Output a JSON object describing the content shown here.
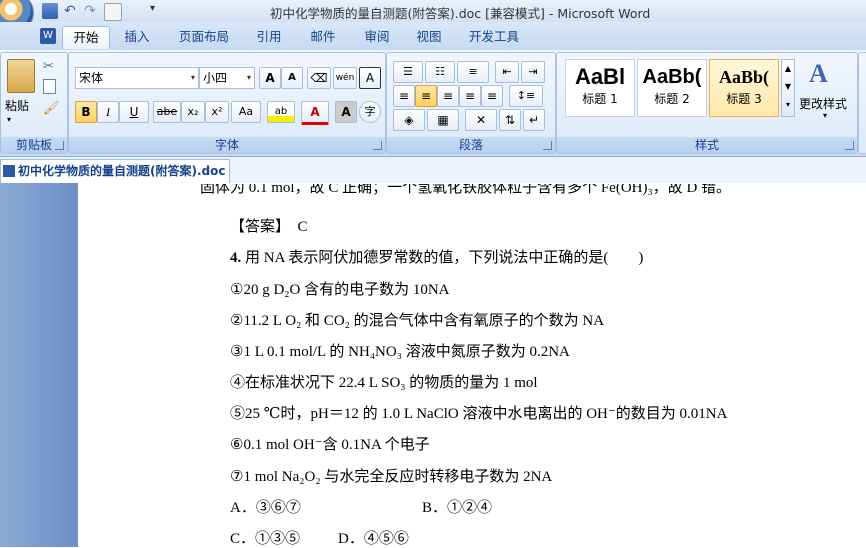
{
  "window": {
    "title": "初中化学物质的量自测题(附答案).doc [兼容模式] - Microsoft Word"
  },
  "tabs": [
    "开始",
    "插入",
    "页面布局",
    "引用",
    "邮件",
    "审阅",
    "视图",
    "开发工具"
  ],
  "ribbon": {
    "clipboard": {
      "label": "剪贴板",
      "paste": "粘贴"
    },
    "font": {
      "label": "字体",
      "font_name": "宋体",
      "font_size": "小四",
      "grow": "A",
      "shrink": "A",
      "bold": "B",
      "italic": "I",
      "underline": "U",
      "strike": "abe",
      "sub": "x₂",
      "sup": "x²",
      "case": "Aa",
      "wen": "wén",
      "char_border": "A",
      "char_shade": "A",
      "circle": "字"
    },
    "paragraph": {
      "label": "段落"
    },
    "styles": {
      "label": "样式",
      "items": [
        {
          "sample": "AaBl",
          "name": "标题 1"
        },
        {
          "sample": "AaBb(",
          "name": "标题 2"
        },
        {
          "sample": "AaBb(",
          "name": "标题 3"
        }
      ],
      "change_styles": "更改样式"
    }
  },
  "document_tab": "初中化学物质的量自测题(附答案).doc",
  "document": {
    "partial_line": "固体为 0.1 mol，故 C 正确；一个氢氧化铁胶体粒子含有多个 Fe(OH)₃，故 D 错。",
    "answer_label": "【答案】",
    "answer_value": "C",
    "question_number": "4.",
    "question_text": "用 NA 表示阿伏加德罗常数的值，下列说法中正确的是(　　)",
    "items": [
      "①20 g D₂O 含有的电子数为 10NA",
      "②11.2 L O₂ 和 CO₂ 的混合气体中含有氧原子的个数为 NA",
      "③1 L 0.1 mol/L 的 NH₄NO₃ 溶液中氮原子数为 0.2NA",
      "④在标准状况下 22.4 L SO₃ 的物质的量为 1 mol",
      "⑤25 ℃时，pH＝12 的 1.0 L NaClO 溶液中水电离出的 OH⁻的数目为 0.01NA",
      "⑥0.1 mol OH⁻含 0.1NA 个电子",
      "⑦1 mol Na₂O₂ 与水完全反应时转移电子数为 2NA"
    ],
    "options": {
      "A": "A．③⑥⑦",
      "B": "B．①②④",
      "C": "C．①③⑤",
      "D": "D．④⑤⑥"
    }
  }
}
